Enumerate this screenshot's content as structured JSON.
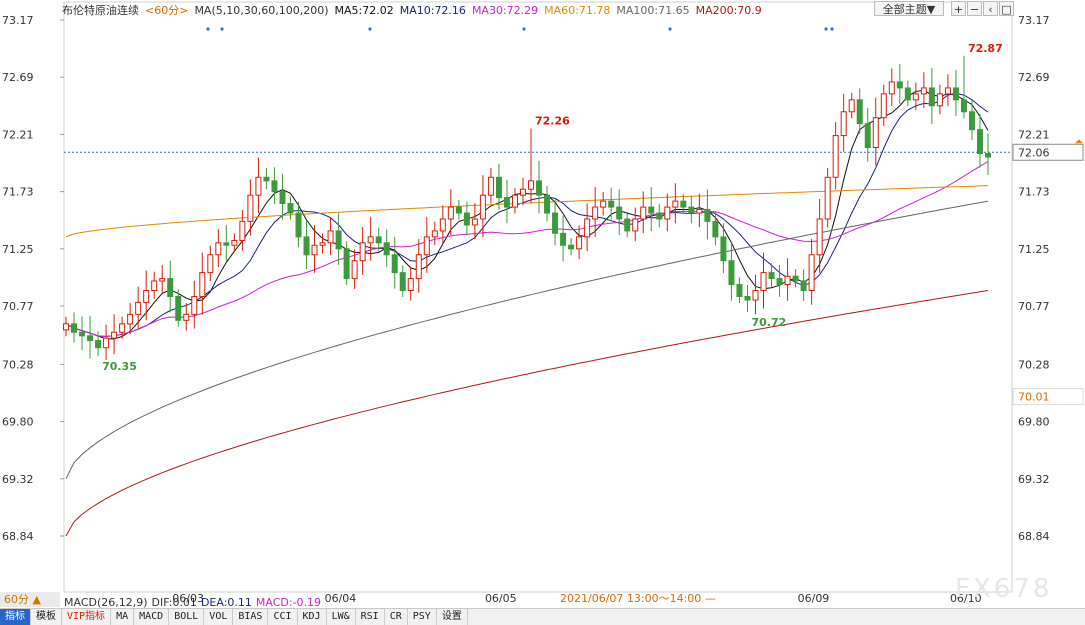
{
  "header": {
    "symbol": "布伦特原油连续",
    "period": "<60分>",
    "ma_spec": "MA(5,10,30,60,100,200)",
    "ma5": "MA5:72.02",
    "ma10": "MA10:72.16",
    "ma30": "MA30:72.29",
    "ma60": "MA60:71.78",
    "ma100": "MA100:71.65",
    "ma200": "MA200:70.9",
    "theme_button": "全部主题▼"
  },
  "colors": {
    "up": "#d81e06",
    "down": "#3c9a3c",
    "ma5": "#111111",
    "ma10": "#1a237e",
    "ma30": "#cc22cc",
    "ma60": "#e08a00",
    "ma100": "#666666",
    "ma200": "#b01818"
  },
  "icons": [
    "zoom-in-icon",
    "zoom-out-icon",
    "back-icon",
    "fullscreen-icon"
  ],
  "chart_data": {
    "type": "candlestick",
    "y_ticks": [
      "73.17",
      "72.69",
      "72.21",
      "71.73",
      "71.25",
      "70.77",
      "70.28",
      "69.80",
      "69.32",
      "68.84"
    ],
    "ylim": [
      68.84,
      73.17
    ],
    "x_labels": [
      "06/03",
      "06/04",
      "06/05",
      "06/09",
      "06/10"
    ],
    "x_label_index": [
      15,
      34,
      54,
      93,
      112
    ],
    "candles": 116,
    "last_price": "72.06",
    "left_price": "70.01",
    "annotations": [
      {
        "text": "72.26",
        "index": 58,
        "value": 72.26
      },
      {
        "text": "72.87",
        "index": 112,
        "value": 72.87
      },
      {
        "text": "70.35",
        "index": 4,
        "value": 70.35
      },
      {
        "text": "70.72",
        "index": 85,
        "value": 70.72
      }
    ],
    "closes": [
      70.62,
      70.55,
      70.52,
      70.48,
      70.42,
      70.5,
      70.55,
      70.62,
      70.7,
      70.8,
      70.9,
      70.98,
      71.0,
      70.85,
      70.65,
      70.7,
      70.85,
      71.05,
      71.2,
      71.3,
      71.28,
      71.32,
      71.48,
      71.7,
      71.85,
      71.82,
      71.73,
      71.63,
      71.55,
      71.35,
      71.2,
      71.28,
      71.3,
      71.4,
      71.25,
      71.0,
      71.15,
      71.3,
      71.35,
      71.3,
      71.2,
      71.05,
      70.9,
      71.0,
      71.2,
      71.35,
      71.4,
      71.5,
      71.6,
      71.55,
      71.45,
      71.5,
      71.7,
      71.85,
      71.68,
      71.6,
      71.7,
      71.75,
      71.82,
      71.7,
      71.55,
      71.38,
      71.28,
      71.25,
      71.35,
      71.5,
      71.6,
      71.65,
      71.6,
      71.5,
      71.4,
      71.5,
      71.6,
      71.55,
      71.5,
      71.6,
      71.65,
      71.6,
      71.55,
      71.58,
      71.48,
      71.35,
      71.15,
      70.95,
      70.85,
      70.82,
      70.9,
      71.05,
      71.0,
      70.95,
      71.02,
      70.98,
      70.9,
      71.2,
      71.5,
      71.85,
      72.2,
      72.4,
      72.5,
      72.3,
      72.1,
      72.35,
      72.55,
      72.65,
      72.6,
      72.5,
      72.55,
      72.6,
      72.45,
      72.55,
      72.6,
      72.5,
      72.4,
      72.25,
      72.05,
      72.02
    ],
    "ma_series": [
      {
        "name": "MA60",
        "start": 71.35,
        "end": 71.78
      },
      {
        "name": "MA100",
        "start": 69.32,
        "end": 71.65
      },
      {
        "name": "MA200",
        "start": 68.84,
        "end": 70.9
      }
    ]
  },
  "macd": {
    "label": "MACD(26,12,9)",
    "dif": "DIF:0.01",
    "dea": "DEA:0.11",
    "macd": "MACD:-0.19"
  },
  "period_tag": "60分 ▲",
  "range_label": "2021/06/07 13:00～14:00 —",
  "watermark": "FX678",
  "tabs": [
    "指标",
    "模板",
    "VIP指标",
    "MA",
    "MACD",
    "BOLL",
    "VOL",
    "BIAS",
    "CCI",
    "KDJ",
    "LW&",
    "RSI",
    "CR",
    "PSY",
    "设置"
  ]
}
